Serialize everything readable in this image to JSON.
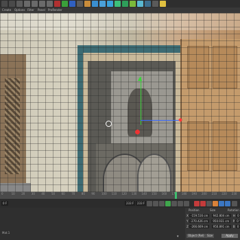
{
  "menubar": {
    "items": [
      "Create",
      "Options",
      "Filter",
      "Panel",
      "ProRender"
    ]
  },
  "toolbar": {
    "icons": [
      {
        "name": "undo-icon",
        "color": "#4a4a4a"
      },
      {
        "name": "redo-icon",
        "color": "#4a4a4a"
      },
      {
        "name": "live-selection-icon",
        "color": "#5c5c5c"
      },
      {
        "name": "move-tool-icon",
        "color": "#6a6a6a"
      },
      {
        "name": "scale-tool-icon",
        "color": "#6a6a6a"
      },
      {
        "name": "rotate-tool-icon",
        "color": "#6a6a6a"
      },
      {
        "name": "recent-tool-icon",
        "color": "#6a6a6a"
      },
      {
        "name": "x-axis-icon",
        "color": "#b03030"
      },
      {
        "name": "y-axis-icon",
        "color": "#3aa03a"
      },
      {
        "name": "z-axis-icon",
        "color": "#3060c0"
      },
      {
        "name": "world-coord-icon",
        "color": "#5a5a5a"
      },
      {
        "name": "render-view-icon",
        "color": "#c98c3a"
      },
      {
        "name": "render-picture-viewer-icon",
        "color": "#3a8fd0"
      },
      {
        "name": "edit-render-settings-icon",
        "color": "#4aa0d8"
      },
      {
        "name": "cube-icon",
        "color": "#3aa0d8"
      },
      {
        "name": "spline-pen-icon",
        "color": "#3cbf7a"
      },
      {
        "name": "subdivision-icon",
        "color": "#2e9e5a"
      },
      {
        "name": "array-icon",
        "color": "#7bb83a"
      },
      {
        "name": "deformer-icon",
        "color": "#5ab8d0"
      },
      {
        "name": "floor-icon",
        "color": "#3c6e8e"
      },
      {
        "name": "camera-icon",
        "color": "#5a5a5a"
      },
      {
        "name": "light-icon",
        "color": "#e0c040"
      }
    ]
  },
  "timeline": {
    "ticks": [
      "0",
      "10",
      "20",
      "30",
      "40",
      "50",
      "60",
      "70",
      "80",
      "90",
      "100",
      "110",
      "120",
      "130",
      "140",
      "150",
      "160",
      "170",
      "180",
      "190",
      "200",
      "210",
      "220",
      "230"
    ],
    "current_frame": "233 F"
  },
  "transport": {
    "start_frame": "0 F",
    "end_frame": "233 F",
    "fps_field": "233 F"
  },
  "coordinates": {
    "headers": {
      "position": "Position",
      "size": "Size",
      "rotation": "Rotation"
    },
    "rows": [
      {
        "axis": "X",
        "position": "-159.516 cm",
        "size": "942.804 cm",
        "rot_label": "H",
        "rotation": "0 °"
      },
      {
        "axis": "Y",
        "position": "-270.426 cm",
        "size": "950.931 cm",
        "rot_label": "P",
        "rotation": "0 °"
      },
      {
        "axis": "Z",
        "position": "-266.669 cm",
        "size": "950.891 cm",
        "rot_label": "B",
        "rotation": "0 °"
      }
    ],
    "mode_dropdown": "Object (Rel)",
    "size_dropdown": "Size",
    "apply_label": "Apply"
  },
  "left_pane": {
    "label": "Mat.1"
  }
}
